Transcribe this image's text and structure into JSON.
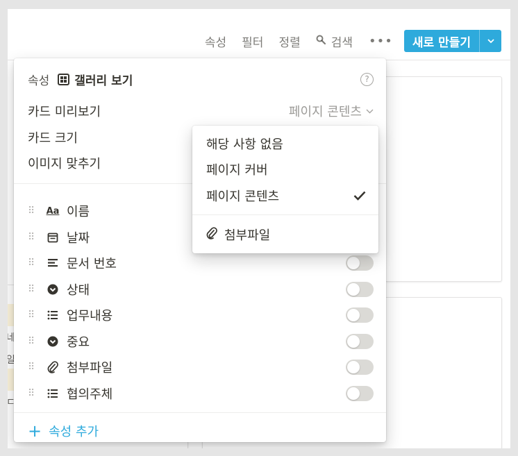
{
  "toolbar": {
    "properties_label": "속성",
    "filter_label": "필터",
    "sort_label": "정렬",
    "search_label": "검색",
    "more_icon": "more-horizontal-icon",
    "new_button_label": "새로 만들기"
  },
  "panel": {
    "breadcrumb_parent": "속성",
    "view_name": "갤러리 보기",
    "options": [
      {
        "label": "카드 미리보기",
        "value": "페이지 콘텐츠"
      },
      {
        "label": "카드 크기"
      },
      {
        "label": "이미지 맞추기"
      }
    ],
    "properties": [
      {
        "icon": "text-icon",
        "icon_text": "Aa",
        "label": "이름",
        "visible": true
      },
      {
        "icon": "calendar-icon",
        "label": "날짜",
        "visible": true
      },
      {
        "icon": "text-lines-icon",
        "label": "문서 번호",
        "visible": false
      },
      {
        "icon": "select-icon",
        "label": "상태",
        "visible": false
      },
      {
        "icon": "list-icon",
        "label": "업무내용",
        "visible": false
      },
      {
        "icon": "select-icon",
        "label": "중요",
        "visible": false
      },
      {
        "icon": "paperclip-icon",
        "label": "첨부파일",
        "visible": false
      },
      {
        "icon": "list-icon",
        "label": "협의주체",
        "visible": false
      }
    ],
    "add_property_label": "속성 추가"
  },
  "preview_menu": {
    "items": [
      {
        "label": "해당 사항 없음",
        "selected": false
      },
      {
        "label": "페이지 커버",
        "selected": false
      },
      {
        "label": "페이지 콘텐츠",
        "selected": true
      }
    ],
    "file_properties": [
      {
        "label": "첨부파일",
        "icon": "paperclip-icon"
      }
    ]
  },
  "background": {
    "cut_text": [
      "네",
      "일",
      "ㄷ"
    ]
  },
  "colors": {
    "accent": "#2EAADC",
    "text": "#37352F",
    "toggle_off": "#D3D1CB"
  }
}
